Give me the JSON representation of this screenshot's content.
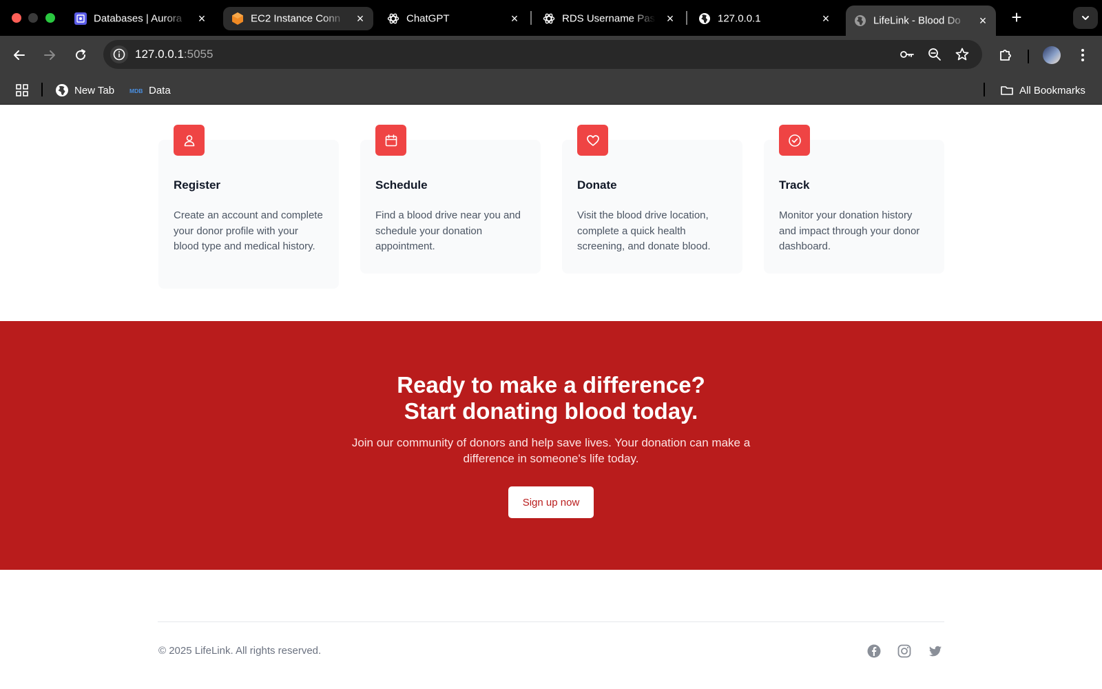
{
  "browser": {
    "tabs": [
      {
        "title": "Databases | Aurora",
        "icon": "rds-icon",
        "active": false
      },
      {
        "title": "EC2 Instance Conn",
        "icon": "ec2-icon",
        "active": false
      },
      {
        "title": "ChatGPT",
        "icon": "chatgpt-icon",
        "active": false
      },
      {
        "title": "RDS Username Pas",
        "icon": "chatgpt-icon",
        "active": false
      },
      {
        "title": "127.0.0.1",
        "icon": "globe-icon",
        "active": false
      },
      {
        "title": "LifeLink - Blood Do",
        "icon": "globe-icon",
        "active": true
      }
    ],
    "close_glyph": "×",
    "new_tab_glyph": "+",
    "url_host": "127.0.0.1",
    "url_port": ":5055",
    "bookmarks": [
      {
        "label": "New Tab",
        "icon": "globe-icon"
      },
      {
        "label": "Data",
        "icon": "mdb-icon"
      }
    ],
    "all_bookmarks_label": "All Bookmarks"
  },
  "steps": [
    {
      "title": "Register",
      "icon": "user-icon",
      "description": "Create an account and complete your donor profile with your blood type and medical history."
    },
    {
      "title": "Schedule",
      "icon": "calendar-icon",
      "description": "Find a blood drive near you and schedule your donation appointment."
    },
    {
      "title": "Donate",
      "icon": "heart-icon",
      "description": "Visit the blood drive location, complete a quick health screening, and donate blood."
    },
    {
      "title": "Track",
      "icon": "check-circle-icon",
      "description": "Monitor your donation history and impact through your donor dashboard."
    }
  ],
  "cta": {
    "heading_line1": "Ready to make a difference?",
    "heading_line2": "Start donating blood today.",
    "body": "Join our community of donors and help save lives. Your donation can make a difference in someone's life today.",
    "button_label": "Sign up now"
  },
  "footer": {
    "copyright": "© 2025 LifeLink. All rights reserved.",
    "social": [
      "facebook-icon",
      "instagram-icon",
      "twitter-icon"
    ]
  },
  "colors": {
    "brand_red": "#ef4444",
    "cta_background": "#b91c1c",
    "chrome_dark": "#3c3c3c"
  }
}
